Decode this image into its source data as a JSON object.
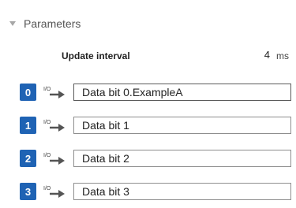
{
  "section": {
    "title": "Parameters"
  },
  "update_interval": {
    "label": "Update interval",
    "value": "4",
    "unit": "ms"
  },
  "rows": [
    {
      "index": "0",
      "io_label": "I/O",
      "value": "Data bit 0.ExampleA"
    },
    {
      "index": "1",
      "io_label": "I/O",
      "value": "Data bit 1"
    },
    {
      "index": "2",
      "io_label": "I/O",
      "value": "Data bit 2"
    },
    {
      "index": "3",
      "io_label": "I/O",
      "value": "Data bit 3"
    }
  ],
  "colors": {
    "badge": "#1f63b4",
    "arrow": "#555555"
  },
  "icons": {
    "caret": "caret-down-icon",
    "io": "io-arrow-icon"
  }
}
